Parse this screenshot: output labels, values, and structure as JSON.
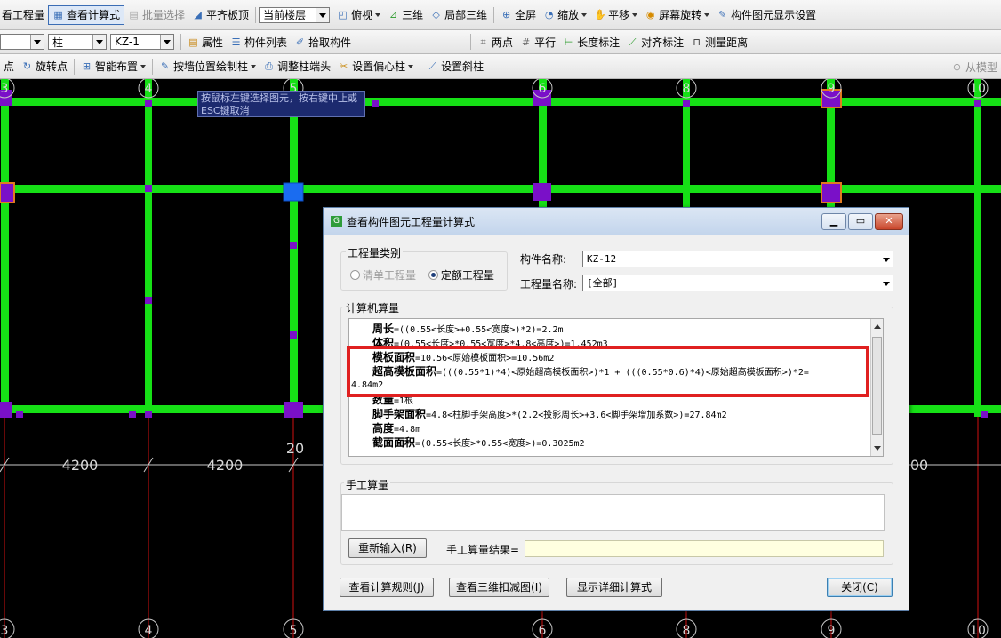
{
  "toolbar1": {
    "items": [
      {
        "label": "看工程量",
        "icon": "table-icon"
      },
      {
        "label": "查看计算式",
        "icon": "calc-view-icon",
        "active": true
      },
      {
        "label": "批量选择",
        "icon": "batch-select-icon",
        "disabled": true
      },
      {
        "label": "平齐板顶",
        "icon": "align-slab-icon"
      },
      {
        "label": "当前楼层",
        "icon": "floor-combo"
      },
      {
        "label": "俯视",
        "icon": "top-view-icon"
      },
      {
        "label": "三维",
        "icon": "3d-icon"
      },
      {
        "label": "局部三维",
        "icon": "partial-3d-icon"
      },
      {
        "label": "全屏",
        "icon": "fullscreen-icon"
      },
      {
        "label": "缩放",
        "icon": "zoom-icon"
      },
      {
        "label": "平移",
        "icon": "pan-icon"
      },
      {
        "label": "屏幕旋转",
        "icon": "rotate-screen-icon"
      },
      {
        "label": "构件图元显示设置",
        "icon": "display-settings-icon"
      }
    ]
  },
  "toolbar2": {
    "type_value": "柱",
    "component_value": "KZ-1",
    "items": [
      {
        "label": "属性",
        "icon": "properties-icon"
      },
      {
        "label": "构件列表",
        "icon": "component-list-icon"
      },
      {
        "label": "拾取构件",
        "icon": "pick-component-icon"
      },
      {
        "label": "两点",
        "icon": "two-points-icon"
      },
      {
        "label": "平行",
        "icon": "parallel-icon"
      },
      {
        "label": "长度标注",
        "icon": "length-dim-icon"
      },
      {
        "label": "对齐标注",
        "icon": "align-dim-icon"
      },
      {
        "label": "测量距离",
        "icon": "measure-icon"
      }
    ]
  },
  "toolbar3": {
    "items": [
      {
        "label": "点",
        "icon": "point-icon"
      },
      {
        "label": "旋转点",
        "icon": "rotate-point-icon"
      },
      {
        "label": "智能布置",
        "icon": "smart-layout-icon"
      },
      {
        "label": "按墙位置绘制柱",
        "icon": "draw-column-icon"
      },
      {
        "label": "调整柱端头",
        "icon": "adjust-end-icon"
      },
      {
        "label": "设置偏心柱",
        "icon": "eccentric-icon"
      },
      {
        "label": "设置斜柱",
        "icon": "slant-column-icon"
      },
      {
        "label": "从模型",
        "icon": "from-model-icon"
      }
    ]
  },
  "canvas": {
    "axis_numbers": [
      "3",
      "4",
      "5",
      "6",
      "8",
      "9",
      "10"
    ],
    "top_axis_numbers": [
      "3",
      "4",
      "5",
      "6",
      "8",
      "9",
      "10"
    ],
    "dimensions": [
      "4200",
      "4200",
      "20",
      "00"
    ],
    "tooltip": "按鼠标左键选择图元，按右键中止或ESC键取消"
  },
  "dialog": {
    "title": "查看构件图元工程量计算式",
    "quantity_type_label": "工程量类别",
    "radio_list": "清单工程量",
    "radio_quota": "定额工程量",
    "component_name_label": "构件名称:",
    "component_name_value": "KZ-12",
    "quantity_name_label": "工程量名称:",
    "quantity_name_value": "[全部]",
    "computer_calc_label": "计算机算量",
    "calc_lines": [
      {
        "name": "周长",
        "formula": "=((0.55<长度>+0.55<宽度>)*2)=2.2m"
      },
      {
        "name": "体积",
        "formula": "=(0.55<长度>*0.55<宽度>*4.8<高度>)=1.452m3"
      },
      {
        "name": "模板面积",
        "formula": "=10.56<原始模板面积>=10.56m2"
      },
      {
        "name": "超高模板面积",
        "formula": "=(((0.55*1)*4)<原始超高模板面积>)*1 + (((0.55*0.6)*4)<原始超高模板面积>)*2="
      },
      {
        "name": "",
        "formula": "4.84m2"
      },
      {
        "name": "数量",
        "formula": "=1根"
      },
      {
        "name": "脚手架面积",
        "formula": "=4.8<柱脚手架高度>*(2.2<投影周长>+3.6<脚手架增加系数>)=27.84m2"
      },
      {
        "name": "高度",
        "formula": "=4.8m"
      },
      {
        "name": "截面面积",
        "formula": "=(0.55<长度>*0.55<宽度>)=0.3025m2"
      }
    ],
    "manual_calc_label": "手工算量",
    "reenter_button": "重新输入(R)",
    "manual_result_label": "手工算量结果=",
    "view_rules_button": "查看计算规则(J)",
    "view_3d_button": "查看三维扣减图(I)",
    "show_detail_button": "显示详细计算式",
    "close_button": "关闭(C)"
  },
  "colors": {
    "beam": "#16e016",
    "column": "#7a10c8",
    "axis": "#d01010",
    "highlight": "#e02020"
  }
}
